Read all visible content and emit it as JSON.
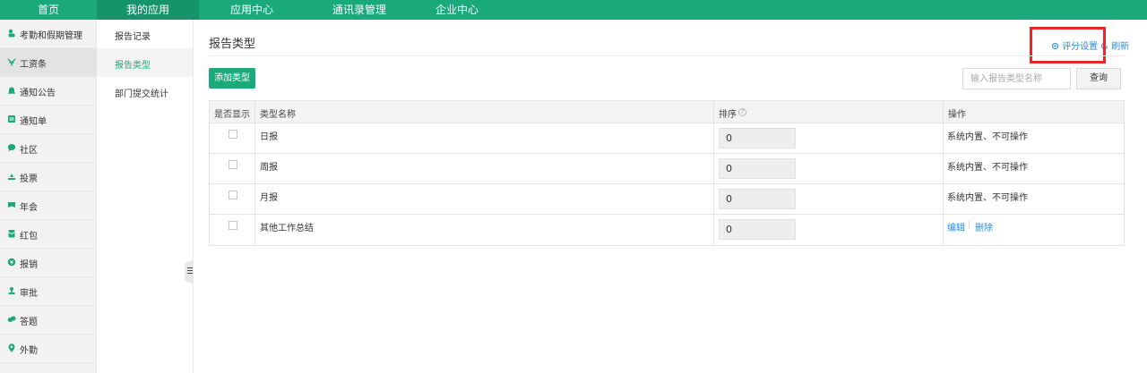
{
  "topnav": {
    "tabs": [
      {
        "label": "首页"
      },
      {
        "label": "我的应用"
      },
      {
        "label": "应用中心"
      },
      {
        "label": "通讯录管理"
      },
      {
        "label": "企业中心"
      }
    ]
  },
  "sidebar": {
    "items": [
      {
        "label": "考勤和假期管理",
        "icon": "attendance-icon"
      },
      {
        "label": "工资条",
        "icon": "payslip-icon"
      },
      {
        "label": "通知公告",
        "icon": "bell-icon"
      },
      {
        "label": "通知单",
        "icon": "notice-form-icon"
      },
      {
        "label": "社区",
        "icon": "chat-bubble-icon"
      },
      {
        "label": "投票",
        "icon": "vote-icon"
      },
      {
        "label": "年会",
        "icon": "banner-icon"
      },
      {
        "label": "红包",
        "icon": "red-envelope-icon"
      },
      {
        "label": "报销",
        "icon": "reimburse-icon"
      },
      {
        "label": "审批",
        "icon": "approval-icon"
      },
      {
        "label": "答题",
        "icon": "quiz-icon"
      },
      {
        "label": "外勤",
        "icon": "location-pin-icon"
      }
    ]
  },
  "submenu": {
    "items": [
      {
        "label": "报告记录"
      },
      {
        "label": "报告类型"
      },
      {
        "label": "部门提交统计"
      }
    ]
  },
  "main": {
    "title": "报告类型",
    "score_settings": "评分设置",
    "refresh": "刷新",
    "add_button": "添加类型",
    "search_placeholder": "输入报告类型名称",
    "query_button": "查询",
    "table": {
      "headers": [
        "是否显示",
        "类型名称",
        "排序",
        "操作"
      ],
      "rows": [
        {
          "name": "日报",
          "sort": "0",
          "op": "系统内置、不可操作"
        },
        {
          "name": "周报",
          "sort": "0",
          "op": "系统内置、不可操作"
        },
        {
          "name": "月报",
          "sort": "0",
          "op": "系统内置、不可操作"
        },
        {
          "name": "其他工作总结",
          "sort": "0",
          "edit": "编辑",
          "delete": "删除"
        }
      ]
    }
  },
  "colors": {
    "brand": "#1aa97b",
    "link": "#2b8ed6",
    "highlight": "#e8272b"
  }
}
